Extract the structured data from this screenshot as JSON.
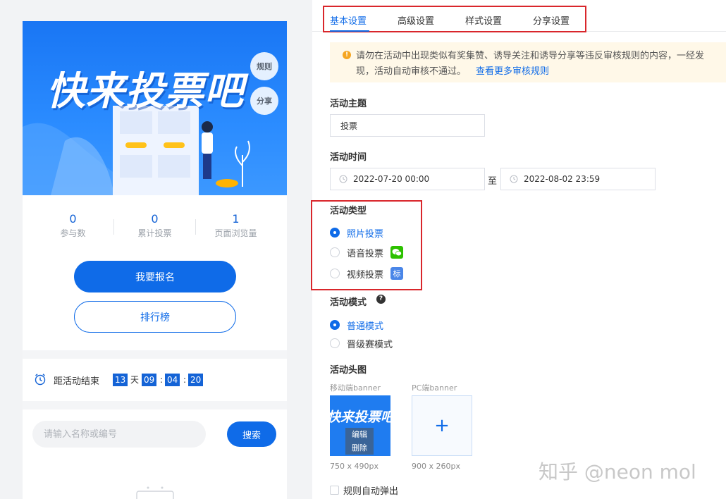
{
  "preview": {
    "banner": {
      "title": "快来投票吧",
      "rule_button": "规则",
      "share_button": "分享"
    },
    "stats": [
      {
        "value": "0",
        "label": "参与数"
      },
      {
        "value": "0",
        "label": "累计投票"
      },
      {
        "value": "1",
        "label": "页面浏览量"
      }
    ],
    "signup_button": "我要报名",
    "ranking_button": "排行榜",
    "countdown": {
      "label": "距活动结束",
      "days": "13",
      "days_unit": "天",
      "hours": "09",
      "minutes": "04",
      "seconds": "20",
      "sep": ":"
    },
    "search": {
      "placeholder": "请输入名称或编号",
      "button": "搜索"
    }
  },
  "tabs": [
    {
      "label": "基本设置",
      "active": true
    },
    {
      "label": "高级设置",
      "active": false
    },
    {
      "label": "样式设置",
      "active": false
    },
    {
      "label": "分享设置",
      "active": false
    }
  ],
  "notice": {
    "icon": "!",
    "line1": "请勿在活动中出现类似有奖集赞、诱导关注和诱导分享等违反审核规则的内容，一经发",
    "line2": "现，活动自动审核不通过。",
    "link": "查看更多审核规则"
  },
  "form": {
    "topic_label": "活动主题",
    "topic_value": "投票",
    "time_label": "活动时间",
    "start_time": "2022-07-20 00:00",
    "to_text": "至",
    "end_time": "2022-08-02 23:59",
    "type_label": "活动类型",
    "type_options": [
      {
        "label": "照片投票",
        "checked": true
      },
      {
        "label": "语音投票",
        "checked": false
      },
      {
        "label": "视频投票",
        "checked": false
      }
    ],
    "type_badge_biao": "标",
    "mode_label": "活动模式",
    "mode_help_icon": "?",
    "mode_options": [
      {
        "label": "普通模式",
        "checked": true
      },
      {
        "label": "晋级赛模式",
        "checked": false
      }
    ],
    "header_label": "活动头图",
    "mobile_banner_label": "移动端banner",
    "pc_banner_label": "PC端banner",
    "thumb_title": "快来投票吧",
    "thumb_edit": "编辑",
    "thumb_delete": "删除",
    "upload_plus": "+",
    "mobile_size": "750 x 490px",
    "pc_size": "900 x 260px",
    "auto_popup_label": "规则自动弹出"
  },
  "watermark": "知乎 @neon mol",
  "colors": {
    "primary": "#0f6be8",
    "highlight_border": "#d9262b",
    "notice_bg": "#fff8e8",
    "wechat_green": "#2dc100"
  }
}
